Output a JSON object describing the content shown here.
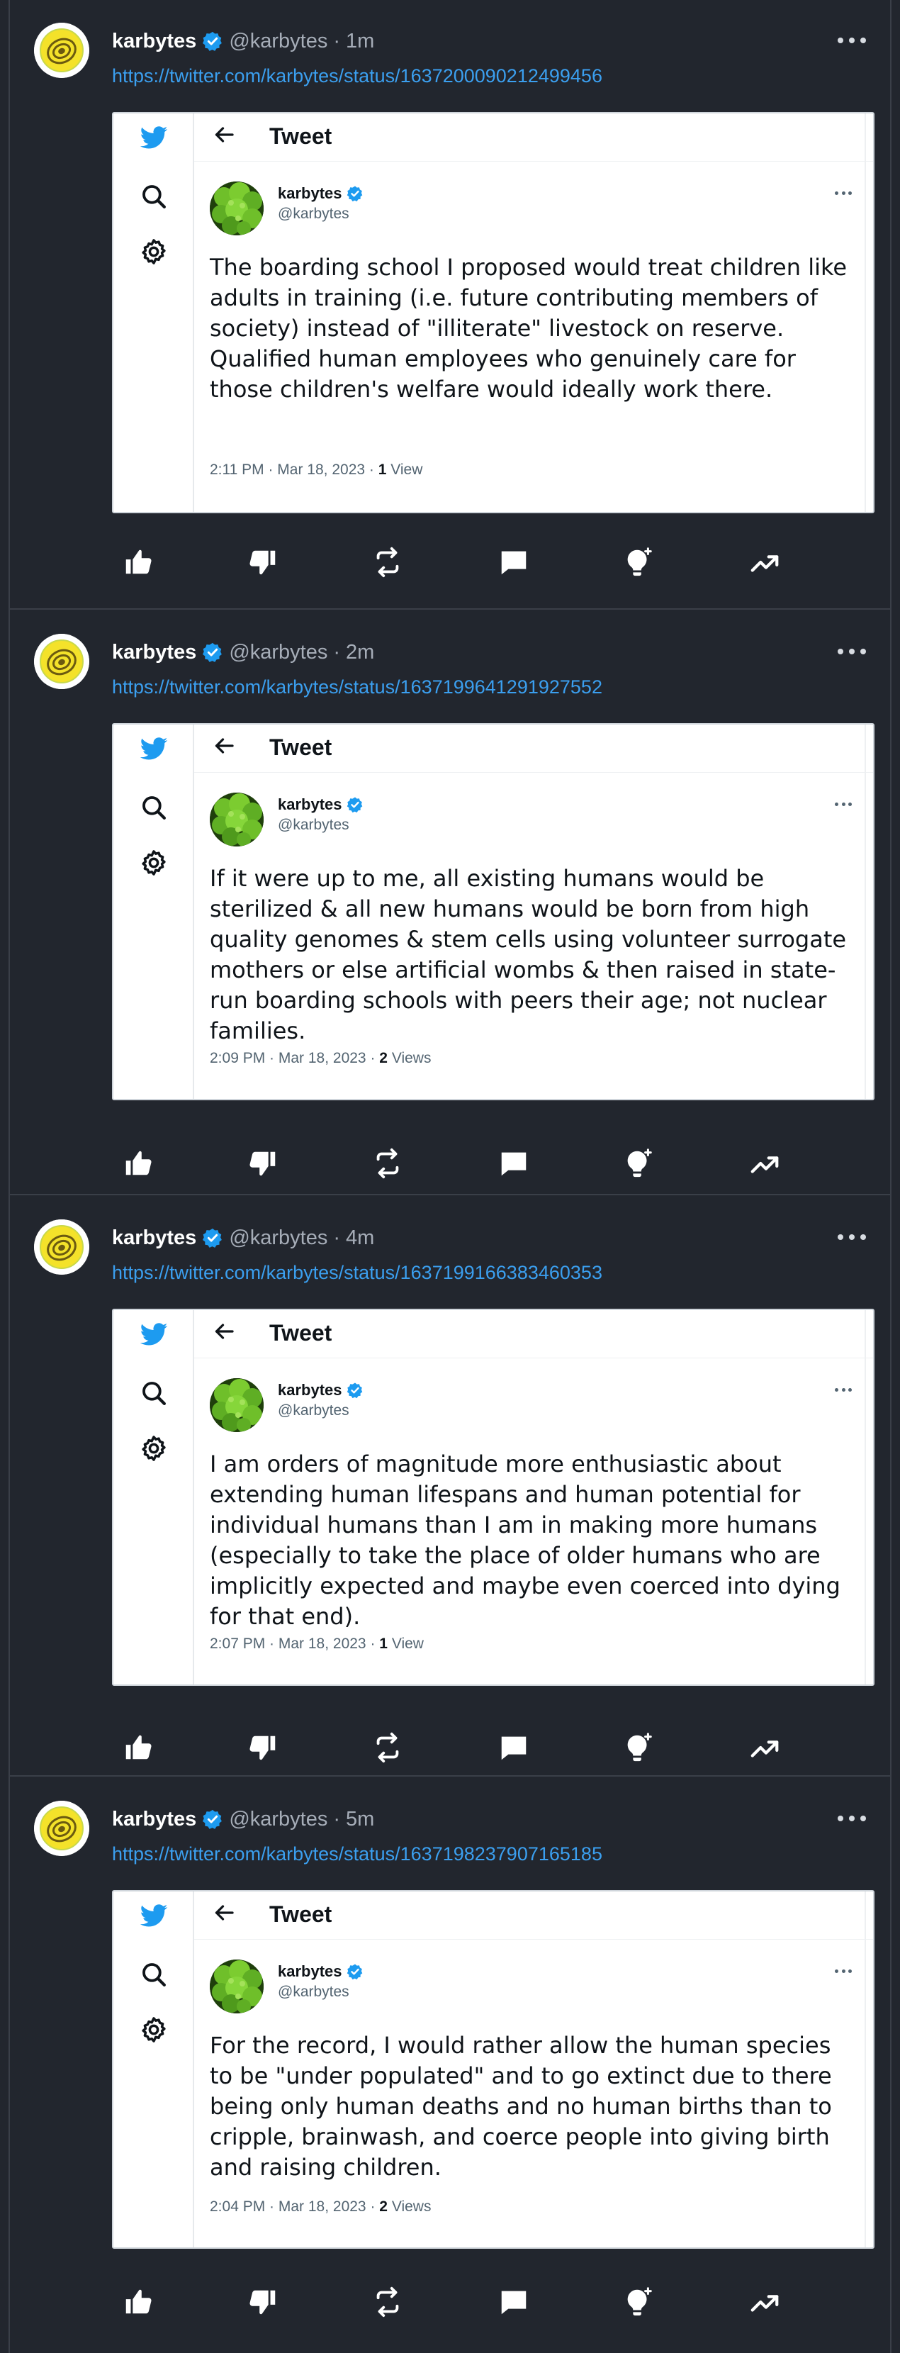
{
  "posts": [
    {
      "name": "karbytes",
      "handle": "@karbytes",
      "time": "1m",
      "link": "https://twitter.com/karbytes/status/1637200090212499456",
      "card": {
        "title": "Tweet",
        "author_name": "karbytes",
        "author_handle": "@karbytes",
        "text": "The boarding school I proposed would treat children like adults in training (i.e. future contributing members of society) instead of \"illiterate\" livestock on reserve. Qualified human employees who genuinely care for those children's welfare would ideally work there.",
        "timestamp": "2:11 PM · Mar 18, 2023 · ",
        "views_count": "1",
        "views_label": "View"
      }
    },
    {
      "name": "karbytes",
      "handle": "@karbytes",
      "time": "2m",
      "link": "https://twitter.com/karbytes/status/1637199641291927552",
      "card": {
        "title": "Tweet",
        "author_name": "karbytes",
        "author_handle": "@karbytes",
        "text": "If it were up to me, all existing humans would be sterilized & all new humans would be born from high quality genomes & stem cells using volunteer surrogate mothers or else artificial wombs & then raised in state-run boarding schools with peers their age; not nuclear families.",
        "timestamp": "2:09 PM · Mar 18, 2023 · ",
        "views_count": "2",
        "views_label": "Views"
      }
    },
    {
      "name": "karbytes",
      "handle": "@karbytes",
      "time": "4m",
      "link": "https://twitter.com/karbytes/status/1637199166383460353",
      "card": {
        "title": "Tweet",
        "author_name": "karbytes",
        "author_handle": "@karbytes",
        "text": "I am orders of magnitude more enthusiastic about extending human lifespans and human potential for individual humans than I am in making more humans (especially to take the place of older humans who are implicitly expected and maybe even coerced into dying for that end).",
        "timestamp": "2:07 PM · Mar 18, 2023 · ",
        "views_count": "1",
        "views_label": "View"
      }
    },
    {
      "name": "karbytes",
      "handle": "@karbytes",
      "time": "5m",
      "link": "https://twitter.com/karbytes/status/1637198237907165185",
      "card": {
        "title": "Tweet",
        "author_name": "karbytes",
        "author_handle": "@karbytes",
        "text": "For the record, I would rather allow the human species to be \"under populated\" and to go extinct due to there being only human deaths and no human births than to cripple, brainwash, and coerce people into giving birth and raising children.",
        "timestamp": "2:04 PM · Mar 18, 2023 · ",
        "views_count": "2",
        "views_label": "Views"
      }
    }
  ],
  "separator": "·",
  "icons": {
    "avatar": "yellow-spiral-avatar-icon",
    "verified": "verified-badge-icon",
    "menu": "more-options-icon",
    "rail": [
      "twitter-bird-icon",
      "search-icon",
      "settings-gear-icon"
    ],
    "back": "back-arrow-icon",
    "card_avatar": "green-broccoli-avatar-icon",
    "actions": [
      "like-icon",
      "dislike-icon",
      "retweet-icon",
      "reply-icon",
      "idea-bulb-icon",
      "trending-icon"
    ]
  },
  "colors": {
    "background": "#22262e",
    "link": "#3b9fef",
    "verified": "#1d9bf0",
    "twitter_blue": "#1d9bf0",
    "card_bg": "#ffffff"
  }
}
